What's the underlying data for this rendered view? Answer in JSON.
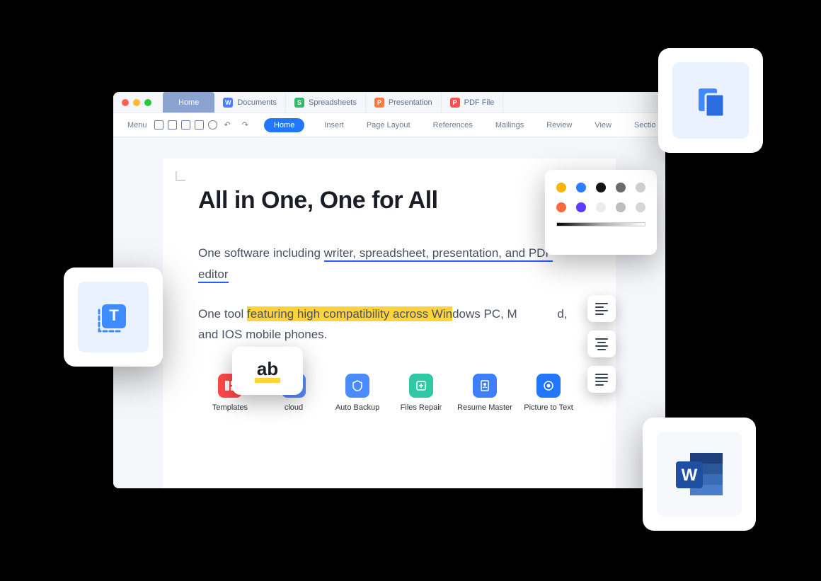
{
  "tabs": {
    "home": "Home",
    "documents": "Documents",
    "spreadsheets": "Spreadsheets",
    "presentation": "Presentation",
    "pdf": "PDF File"
  },
  "toolbar": {
    "menu": "Menu",
    "home_pill": "Home",
    "items": [
      "Insert",
      "Page Layout",
      "References",
      "Mailings",
      "Review",
      "View",
      "Sectio"
    ]
  },
  "document": {
    "title": "All in One, One for All",
    "p1_a": "One software including ",
    "p1_u": "writer, spreadsheet, presentation, and PDF editor",
    "p2_a": "One tool ",
    "p2_hl": "featuring high compatibility across Win",
    "p2_b": "dows PC, M",
    "p2_c": "d, and IOS mobile phones."
  },
  "ab_badge": "ab",
  "features": [
    {
      "label": "Templates"
    },
    {
      "label": "cloud"
    },
    {
      "label": "Auto Backup"
    },
    {
      "label": "Files Repair"
    },
    {
      "label": "Resume Master"
    },
    {
      "label": "Picture to Text"
    }
  ],
  "colors_row1": [
    "#f7b500",
    "#2f7dff",
    "#141414",
    "#6b6b6b",
    "#cfcfcf"
  ],
  "colors_row2": [
    "#ff6a3d",
    "#5b3dff",
    "#ececec",
    "#bdbdbd",
    "#d6d6d6"
  ]
}
